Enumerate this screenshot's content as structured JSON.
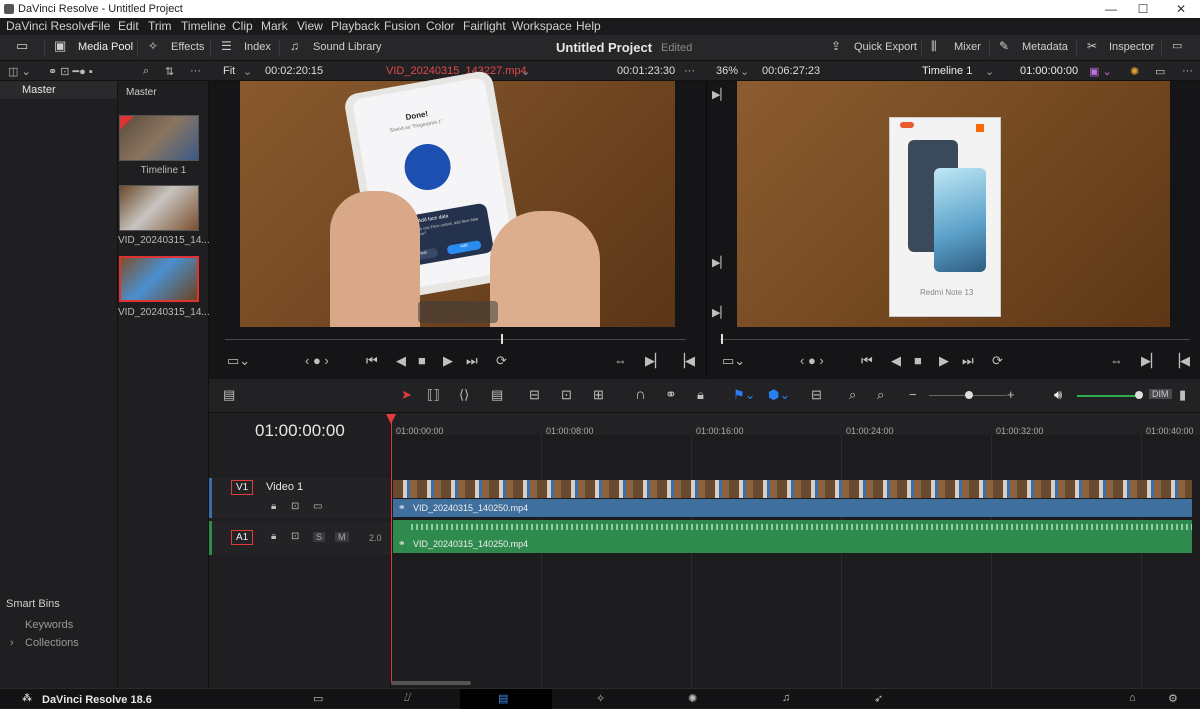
{
  "window": {
    "title": "DaVinci Resolve - Untitled Project",
    "minimize": "—",
    "maximize": "☐",
    "close": "✕"
  },
  "menu": [
    "DaVinci Resolve",
    "File",
    "Edit",
    "Trim",
    "Timeline",
    "Clip",
    "Mark",
    "View",
    "Playback",
    "Fusion",
    "Color",
    "Fairlight",
    "Workspace",
    "Help"
  ],
  "toolbar": {
    "media_pool": "Media Pool",
    "effects": "Effects",
    "index": "Index",
    "sound_library": "Sound Library",
    "project_title": "Untitled Project",
    "edited": "Edited",
    "quick_export": "Quick Export",
    "mixer": "Mixer",
    "metadata": "Metadata",
    "inspector": "Inspector"
  },
  "source_viewer": {
    "zoom": "Fit",
    "timecode_left": "00:02:20:15",
    "clip_name": "VID_20240315_143227.mp4",
    "timecode_right": "00:01:23:30"
  },
  "program_viewer": {
    "zoom": "36%",
    "timecode_left": "00:06:27:23",
    "timeline_name": "Timeline 1",
    "timecode_right": "01:00:00:00"
  },
  "bins": {
    "master": "Master",
    "master_header": "Master",
    "smart_bins": "Smart Bins",
    "keywords": "Keywords",
    "collections": "Collections",
    "collections_arrow": "›"
  },
  "media": [
    {
      "label": "Timeline 1"
    },
    {
      "label": "VID_20240315_14..."
    },
    {
      "label": "VID_20240315_14..."
    }
  ],
  "timeline": {
    "timecode": "01:00:00:00",
    "ruler": [
      "01:00:00:00",
      "01:00:08:00",
      "01:00:16:00",
      "01:00:24:00",
      "01:00:32:00",
      "01:00:40:00"
    ],
    "v1_tag": "V1",
    "v1_name": "Video 1",
    "a1_tag": "A1",
    "a1_level": "2.0",
    "a1_s": "S",
    "a1_m": "M",
    "video_clip": "VID_20240315_140250.mp4",
    "audio_clip": "VID_20240315_140250.mp4",
    "dim": "DIM"
  },
  "phone_screen": {
    "done": "Done!",
    "saved": "Saved as \"Fingerprint 1\"",
    "face_title": "Add face data",
    "face_text": "To be able to use Face unlock, add face data first. Add now?",
    "cancel": "Cancel",
    "add": "Add"
  },
  "box_label": "Redmi Note 13",
  "footer": {
    "app_version": "DaVinci Resolve 18.6"
  },
  "colors": {
    "accent_red": "#e23b3b",
    "video_clip": "#3f6f9c",
    "audio_clip": "#2f8a4d"
  }
}
